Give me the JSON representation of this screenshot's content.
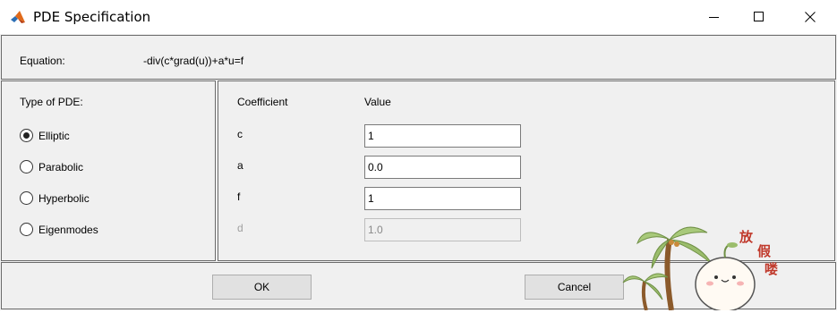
{
  "window": {
    "title": "PDE Specification"
  },
  "equation": {
    "label": "Equation:",
    "value": "-div(c*grad(u))+a*u=f"
  },
  "pde_type": {
    "heading": "Type of PDE:",
    "options": [
      {
        "label": "Elliptic",
        "selected": true
      },
      {
        "label": "Parabolic",
        "selected": false
      },
      {
        "label": "Hyperbolic",
        "selected": false
      },
      {
        "label": "Eigenmodes",
        "selected": false
      }
    ]
  },
  "coefficients": {
    "coefficient_header": "Coefficient",
    "value_header": "Value",
    "rows": [
      {
        "name": "c",
        "value": "1",
        "enabled": true
      },
      {
        "name": "a",
        "value": "0.0",
        "enabled": true
      },
      {
        "name": "f",
        "value": "1",
        "enabled": true
      },
      {
        "name": "d",
        "value": "1.0",
        "enabled": false
      }
    ]
  },
  "buttons": {
    "ok_label": "OK",
    "cancel_label": "Cancel"
  },
  "decoration": {
    "sticker_text": [
      "放",
      "假",
      "喽"
    ]
  }
}
